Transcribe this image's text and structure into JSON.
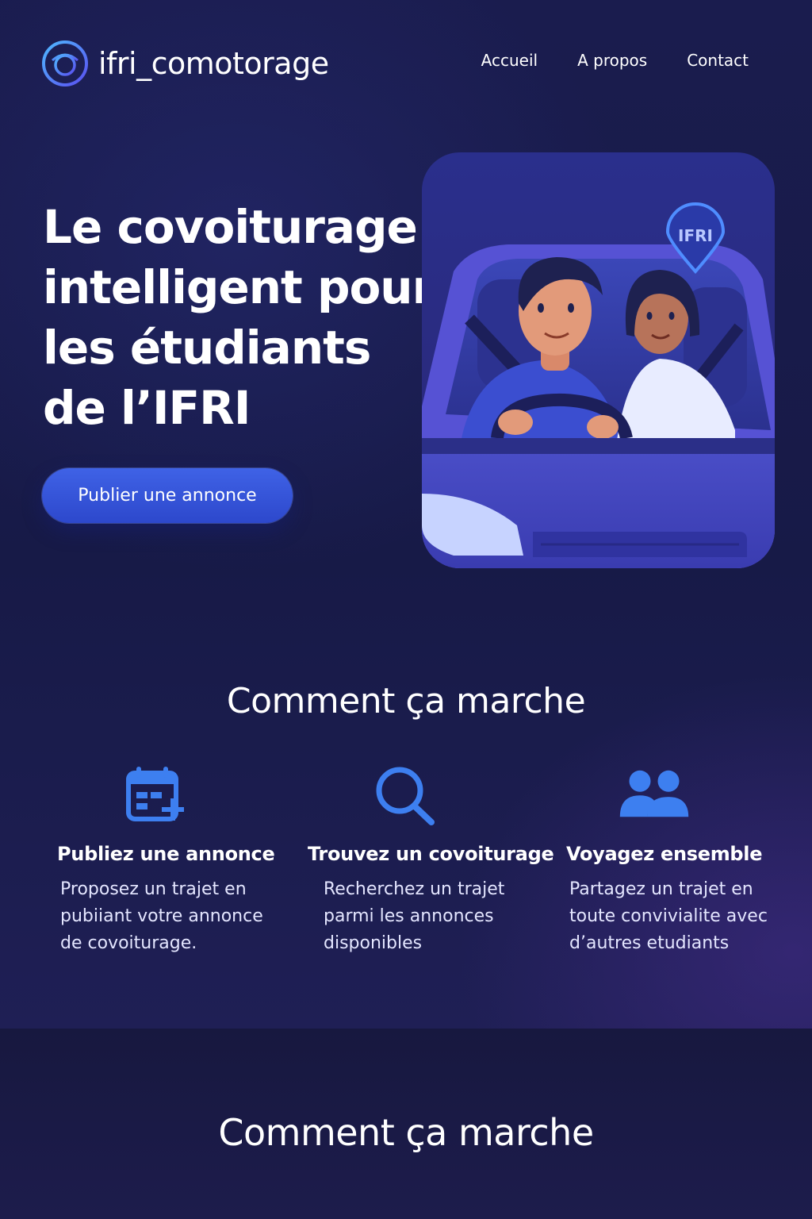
{
  "header": {
    "brand": "ifri_comotorage",
    "nav": [
      "Accueil",
      "A propos",
      "Contact"
    ]
  },
  "hero": {
    "title_lines": [
      "Le covoiturage",
      "intelligent pour",
      "les étudiants",
      "de l’IFRI"
    ],
    "cta_label": "Publier une annonce",
    "illustration_pin_label": "IFRI"
  },
  "how_it_works": {
    "title": "Comment ça marche",
    "steps": [
      {
        "icon": "calendar-add-icon",
        "title": "Publiez une annonce",
        "desc_lines": [
          "Proposez un trajet en",
          "pubiiant votre annonce",
          "de covoiturage."
        ]
      },
      {
        "icon": "search-icon",
        "title": "Trouvez un covoiturage",
        "desc_lines": [
          "Recherchez un trajet",
          "parmi les annonces",
          "disponibles"
        ]
      },
      {
        "icon": "users-icon",
        "title": "Voyagez ensemble",
        "desc_lines": [
          "Partagez un trajet en",
          "toute convivialite avec",
          "d’autres etudiants"
        ]
      }
    ]
  },
  "second_section": {
    "title": "Comment ça marche"
  },
  "colors": {
    "background": "#171a47",
    "accent": "#3f62e6",
    "icon_blue": "#3d7ff0"
  }
}
